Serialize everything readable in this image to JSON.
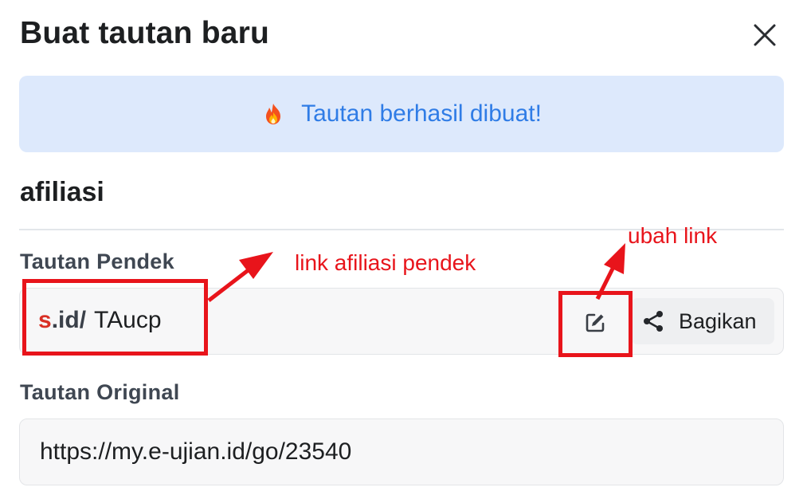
{
  "dialog": {
    "title": "Buat tautan baru",
    "close_icon": "close-icon"
  },
  "alert": {
    "icon": "fire-icon",
    "text": "Tautan berhasil dibuat!",
    "background": "#dde9fc",
    "text_color": "#2f7ce6"
  },
  "link": {
    "name": "afiliasi",
    "short_label": "Tautan Pendek",
    "short_prefix_s": "s",
    "short_prefix_dot": ".",
    "short_prefix_domain": "id/",
    "short_code": "TAucp",
    "edit_icon": "edit-icon",
    "share_icon": "share-icon",
    "share_label": "Bagikan",
    "original_label": "Tautan Original",
    "original_url": "https://my.e-ujian.id/go/23540"
  },
  "annotations": {
    "short_link_note": "link afiliasi pendek",
    "edit_note": "ubah link",
    "color": "#e8141b"
  }
}
